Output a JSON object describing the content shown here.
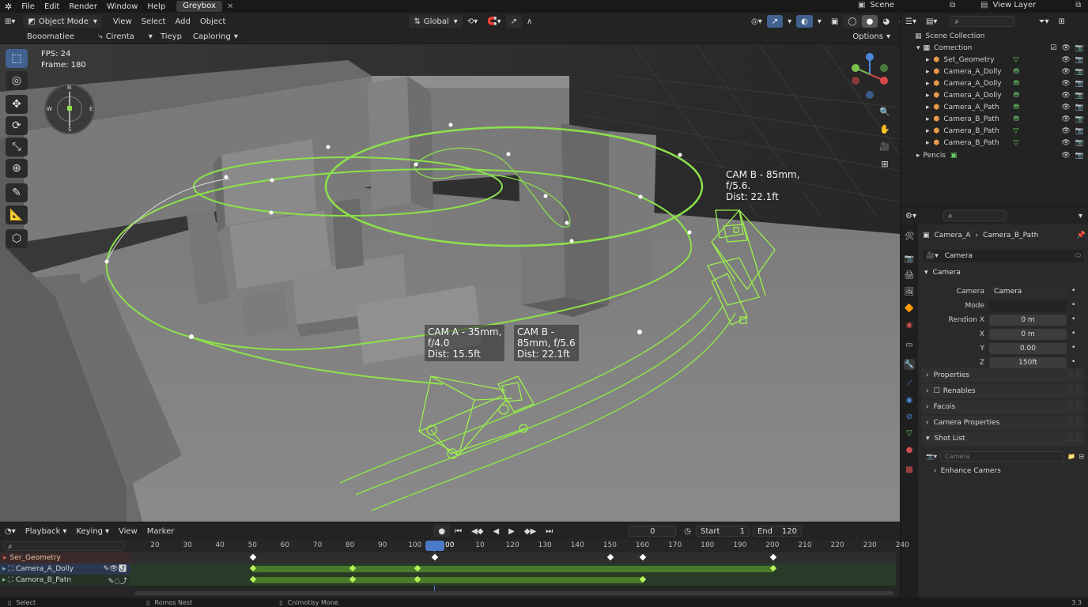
{
  "menubar": {
    "items": [
      "File",
      "Edit",
      "Render",
      "Window",
      "Help"
    ],
    "workspace_tab": "Greybox",
    "scene": "Scene",
    "view_layer": "View Layer"
  },
  "viewport_header": {
    "mode": "Object Mode",
    "menus": [
      "View",
      "Select",
      "Add",
      "Object"
    ],
    "orientation": "Global",
    "row2": {
      "a": "Booomatiee",
      "b": "Cirenta",
      "c": "Tieyp",
      "d": "Caploring"
    },
    "options": "Options"
  },
  "overlay": {
    "fps": "FPS: 24",
    "frame": "Frame: 180"
  },
  "compass": {
    "n": "N",
    "s": "S",
    "e": "E",
    "w": "W"
  },
  "labels": {
    "cam_b_top": "CAM B - 85mm,\nf/5.6.\nDist: 22.1ft",
    "cam_a": "CAM A - 35mm,\nf/4.0\nDist: 15.5ft",
    "cam_b": "CAM B -\n85mm, f/5.6\nDist: 22.1ft"
  },
  "outliner": {
    "root": "Scene Collection",
    "collection": "Comection",
    "items": [
      "Set_Geometry",
      "Camera_A_Dolly",
      "Camera_A_Dolly",
      "Camera_A_Dolly",
      "Camera_A_Path",
      "Camera_B_Path",
      "Camera_B_Path",
      "Camera_B_Path"
    ],
    "last": "Pencis"
  },
  "properties": {
    "breadcrumb": [
      "Camera_A",
      "Camera_B_Path"
    ],
    "datablock": "Camera",
    "section": "Camera",
    "fields": [
      {
        "label": "Camera",
        "value": "Camera"
      },
      {
        "label": "Mode",
        "value": ""
      },
      {
        "label": "Rendion X",
        "value": "0 m"
      },
      {
        "label": "X",
        "value": "0 m"
      },
      {
        "label": "Y",
        "value": "0.00"
      },
      {
        "label": "Z",
        "value": "150ft"
      }
    ],
    "panels": [
      "Properties",
      "Renables",
      "Facois",
      "Camera Properties",
      "Shot List"
    ],
    "shot_placeholder": "Camera",
    "enhance": "Enhance Camers"
  },
  "timeline": {
    "menus": [
      "Playback",
      "Keying",
      "View",
      "Marker"
    ],
    "current": "0",
    "start_label": "Start",
    "start": "1",
    "end_label": "End",
    "end": "120",
    "ticks": [
      "20",
      "30",
      "40",
      "50",
      "60",
      "70",
      "80",
      "90",
      "100",
      "100",
      "10",
      "120",
      "130",
      "140",
      "150",
      "160",
      "170",
      "180",
      "190",
      "200",
      "210",
      "220",
      "230",
      "240"
    ],
    "tracks": [
      "Ser_Geometry",
      "Camera_A_Dolly",
      "Camora_B_Patn"
    ]
  },
  "status": {
    "select": "Select",
    "middle": "Romos Nest",
    "right": "Cnimotisy Mone",
    "version": "3.3"
  }
}
